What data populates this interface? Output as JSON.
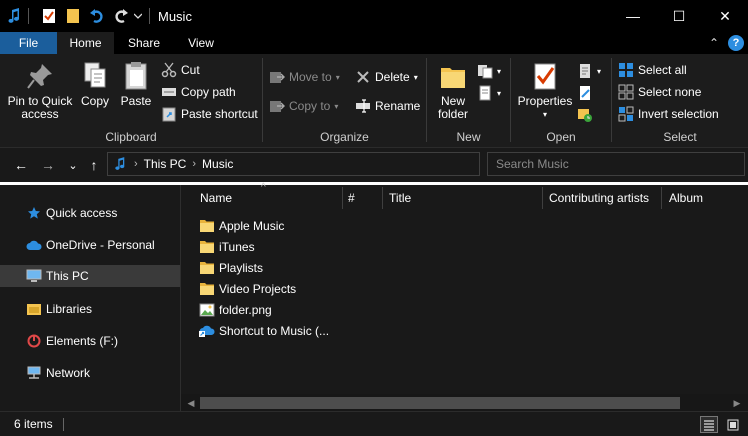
{
  "window": {
    "title": "Music",
    "minimize_glyph": "—",
    "maximize_glyph": "☐",
    "close_glyph": "✕"
  },
  "quick_access_toolbar": {
    "icons": [
      "music-note-icon",
      "properties-check-icon",
      "new-folder-icon",
      "undo-icon",
      "redo-icon",
      "customize-dropdown-icon"
    ]
  },
  "ribbon_tabs": {
    "file": "File",
    "home": "Home",
    "share": "Share",
    "view": "View",
    "collapse_glyph": "⌃",
    "help_glyph": "?"
  },
  "ribbon": {
    "clipboard": {
      "label": "Clipboard",
      "pin_label_line1": "Pin to Quick",
      "pin_label_line2": "access",
      "copy": "Copy",
      "paste": "Paste",
      "cut": "Cut",
      "copy_path": "Copy path",
      "paste_shortcut": "Paste shortcut"
    },
    "organize": {
      "label": "Organize",
      "move_to": "Move to",
      "copy_to": "Copy to",
      "delete": "Delete",
      "rename": "Rename"
    },
    "new": {
      "label": "New",
      "new_folder_line1": "New",
      "new_folder_line2": "folder"
    },
    "open": {
      "label": "Open",
      "properties": "Properties"
    },
    "select": {
      "label": "Select",
      "select_all": "Select all",
      "select_none": "Select none",
      "invert_selection": "Invert selection"
    }
  },
  "navigation": {
    "back_glyph": "←",
    "forward_glyph": "→",
    "recent_glyph": "⌄",
    "up_glyph": "↑",
    "breadcrumbs": [
      "This PC",
      "Music"
    ],
    "breadcrumb_sep": "›",
    "search_placeholder": "Search Music"
  },
  "nav_pane": {
    "items": [
      {
        "label": "Quick access",
        "icon": "star-icon",
        "selected": false
      },
      {
        "label": "OneDrive - Personal",
        "icon": "cloud-icon",
        "selected": false
      },
      {
        "label": "This PC",
        "icon": "computer-icon",
        "selected": true
      },
      {
        "label": "Libraries",
        "icon": "libraries-icon",
        "selected": false
      },
      {
        "label": "Elements (F:)",
        "icon": "drive-icon",
        "selected": false
      },
      {
        "label": "Network",
        "icon": "network-icon",
        "selected": false
      }
    ]
  },
  "file_list": {
    "columns": [
      "Name",
      "#",
      "Title",
      "Contributing artists",
      "Album"
    ],
    "sort_glyph": "^",
    "rows": [
      {
        "name": "Apple Music",
        "icon": "folder-icon"
      },
      {
        "name": "iTunes",
        "icon": "folder-icon"
      },
      {
        "name": "Playlists",
        "icon": "folder-icon"
      },
      {
        "name": "Video Projects",
        "icon": "folder-icon"
      },
      {
        "name": "folder.png",
        "icon": "image-file-icon"
      },
      {
        "name": "Shortcut to Music (...",
        "icon": "shortcut-icon"
      }
    ]
  },
  "status_bar": {
    "item_count": "6 items"
  },
  "colors": {
    "background": "#191919",
    "ribbon": "#1c1c1c",
    "file_tab": "#1b5e9c",
    "selected_nav": "#3a3a3a",
    "folder": "#f4c44f",
    "accent_blue": "#2d8ee0"
  }
}
